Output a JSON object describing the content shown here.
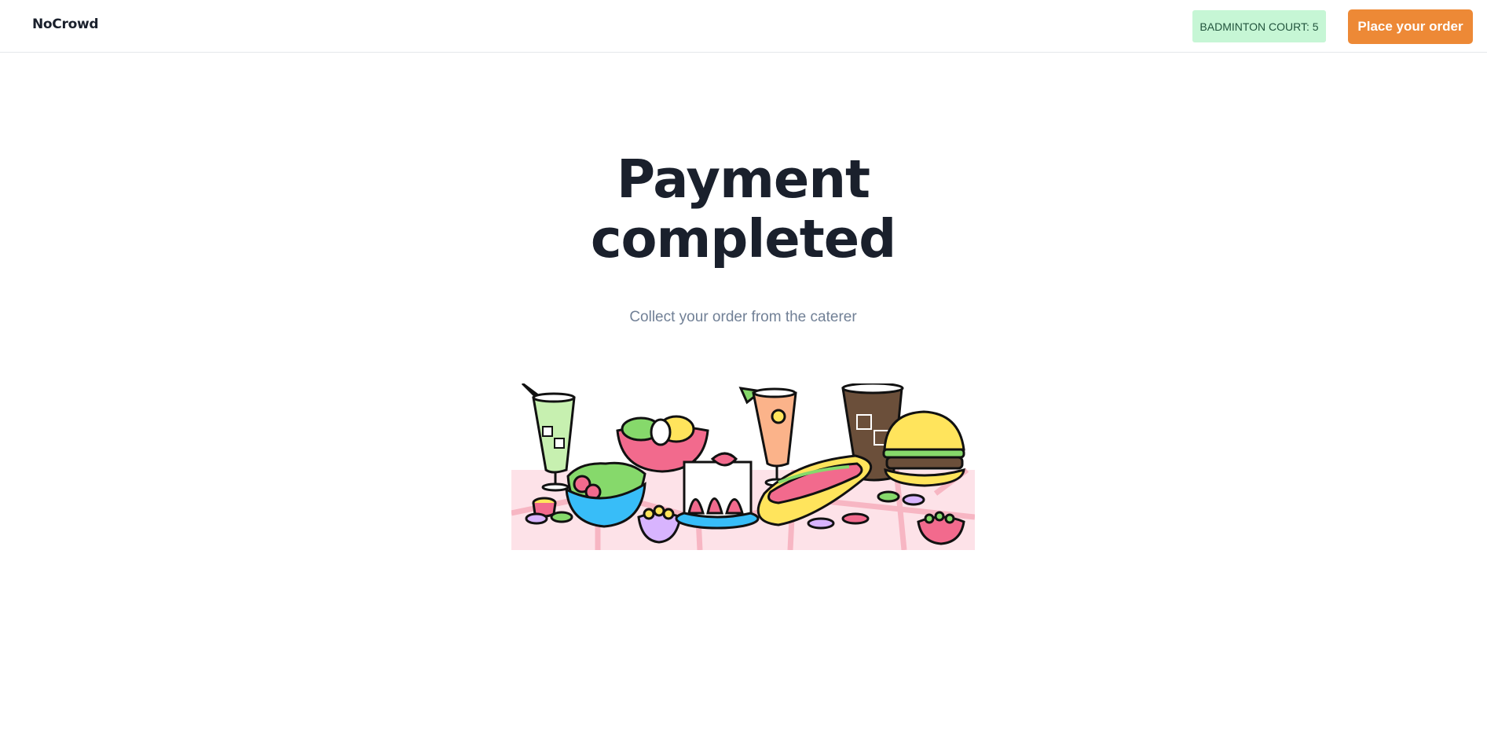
{
  "header": {
    "brand": "NoCrowd",
    "court_badge": "BADMINTON COURT: 5",
    "order_button": "Place your order"
  },
  "main": {
    "title_line1": "Payment",
    "title_line2": "completed",
    "subtitle": "Collect your order from the caterer"
  },
  "illustration": {
    "name": "picnic-food-illustration",
    "colors": {
      "tablecloth": "#fde2e8",
      "tablecloth_lines": "#f7b6c3",
      "outline": "#111111",
      "pink": "#f26a8d",
      "yellow": "#ffe45c",
      "blue": "#38bdf8",
      "green": "#86d96b",
      "brown": "#6b4f3a",
      "orange": "#fbb38a",
      "lavender": "#d8b4fe"
    }
  }
}
